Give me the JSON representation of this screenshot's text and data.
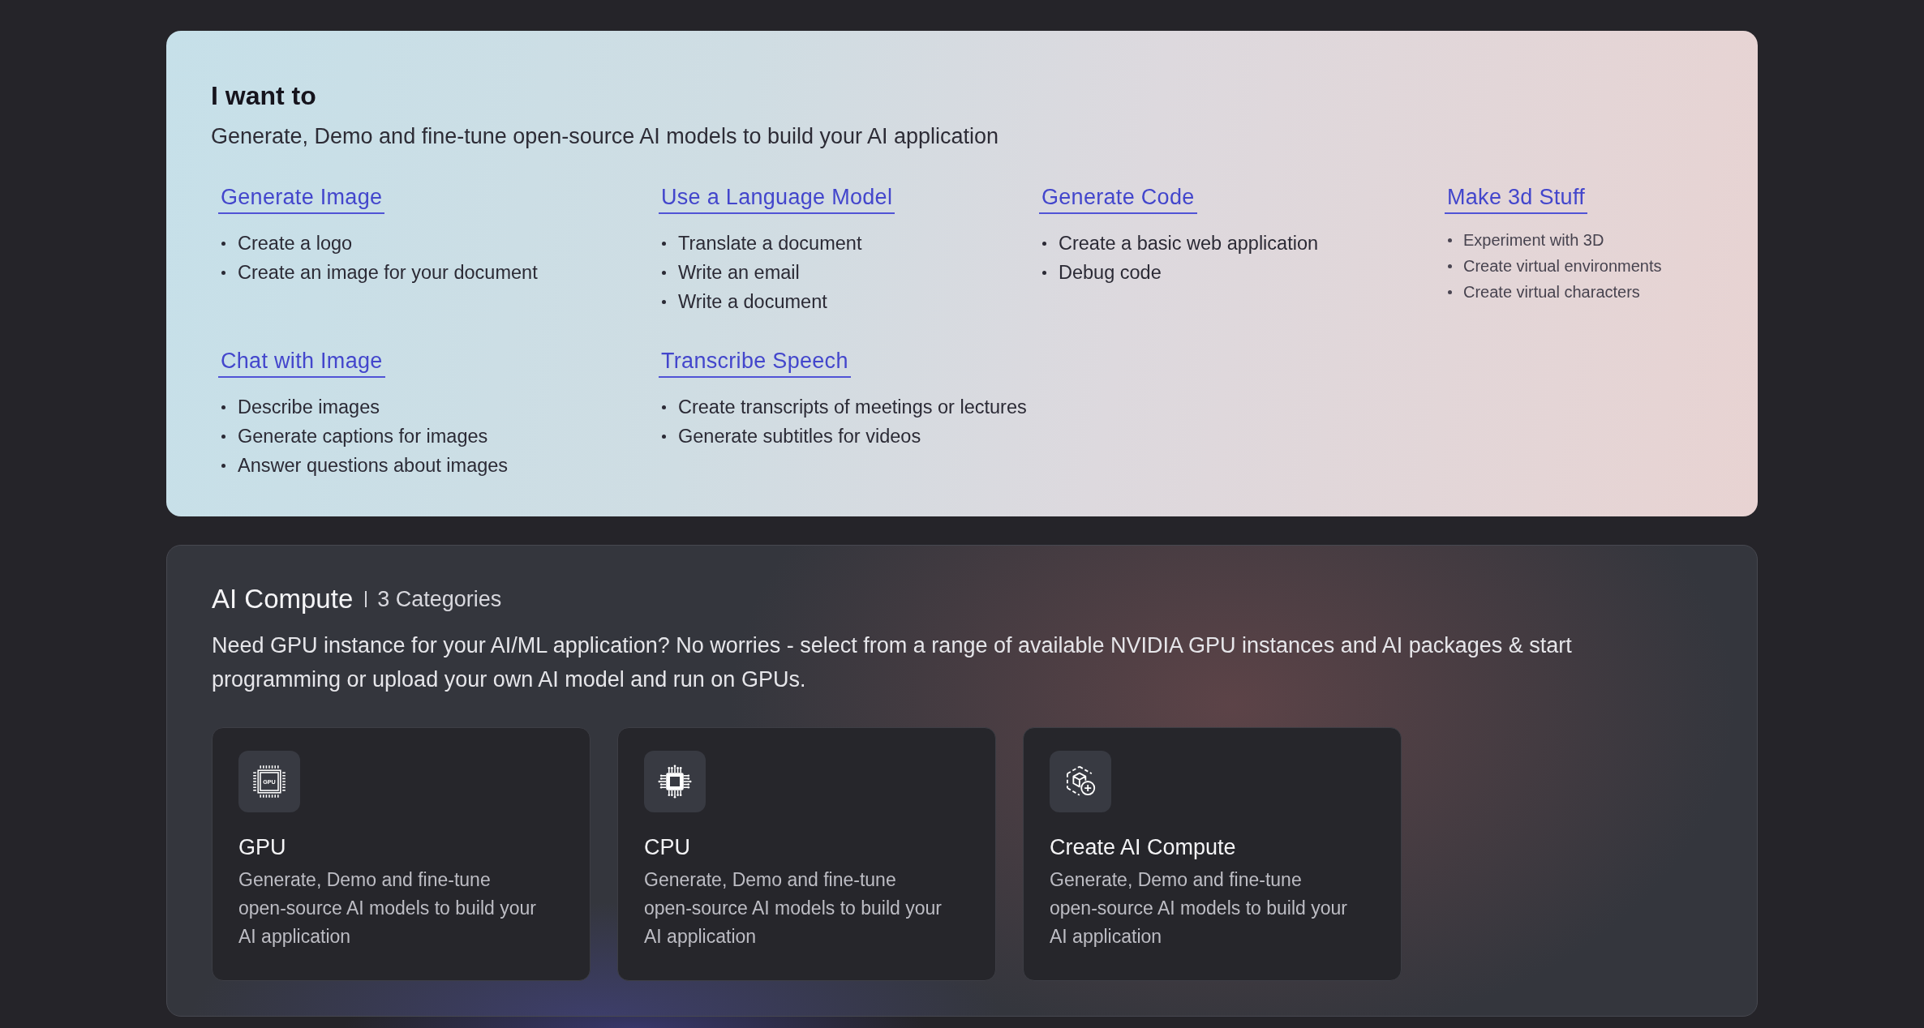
{
  "intro": {
    "title": "I want to",
    "subtitle": "Generate, Demo and fine-tune open-source AI models to build your AI application",
    "categories": [
      {
        "title": "Generate Image",
        "kind": "standard",
        "items": [
          "Create a logo",
          "Create an image for your document"
        ]
      },
      {
        "title": "Use a Language Model",
        "kind": "standard",
        "items": [
          "Translate a document",
          "Write an email",
          "Write a document"
        ]
      },
      {
        "title": "Generate Code",
        "kind": "standard",
        "items": [
          "Create a basic web application",
          "Debug code"
        ]
      },
      {
        "title": "Make 3d Stuff",
        "kind": "compact",
        "items": [
          "Experiment with 3D",
          "Create virtual environments",
          "Create virtual characters"
        ]
      },
      {
        "title": "Chat with Image",
        "kind": "standard",
        "items": [
          "Describe images",
          "Generate captions for images",
          "Answer questions about images"
        ]
      },
      {
        "title": "Transcribe Speech",
        "kind": "standard",
        "items": [
          "Create transcripts of meetings or lectures",
          "Generate subtitles for videos"
        ]
      }
    ]
  },
  "compute": {
    "title": "AI Compute",
    "count": "3 Categories",
    "description": "Need GPU instance for your AI/ML application? No worries - select from a range of available NVIDIA GPU instances and AI packages & start programming or upload your own AI model and run on GPUs.",
    "cards": [
      {
        "kind": "gpu",
        "icon_label": "GPU",
        "title": "GPU",
        "description": "Generate, Demo and fine-tune open-source AI models to build your AI application"
      },
      {
        "kind": "cpu",
        "title": "CPU",
        "description": "Generate, Demo and fine-tune open-source AI models to build your AI application"
      },
      {
        "kind": "create",
        "title": "Create AI Compute",
        "description": "Generate, Demo and fine-tune open-source AI models to build your AI application"
      }
    ]
  }
}
